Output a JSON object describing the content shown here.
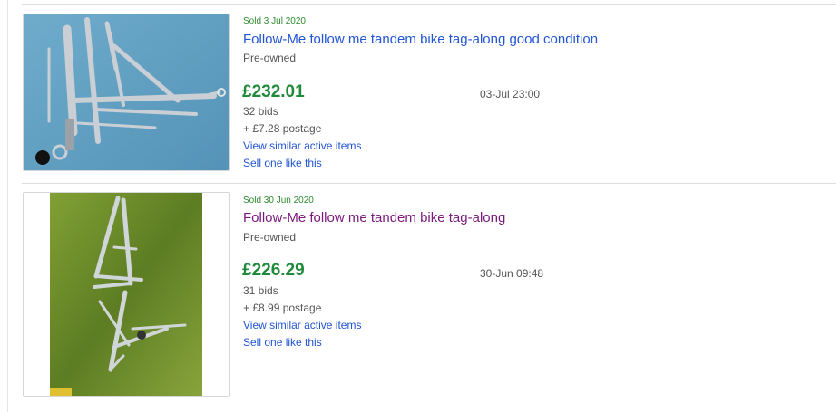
{
  "colors": {
    "price_green": "#1f8a3a",
    "link_blue": "#2155d4",
    "visited_purple": "#7a1a7c",
    "sold_green": "#2f8a2f"
  },
  "listings": [
    {
      "sold_label": "Sold 3 Jul 2020",
      "title": "Follow-Me follow me tandem bike tag-along good condition",
      "condition": "Pre-owned",
      "price": "£232.01",
      "end_time": "03-Jul 23:00",
      "bids": "32 bids",
      "postage": "+ £7.28 postage",
      "view_similar": "View similar active items",
      "sell_one": "Sell one like this",
      "image_alt": "Silver tag-along frame on blue background"
    },
    {
      "sold_label": "Sold 30 Jun 2020",
      "title": "Follow-Me follow me tandem bike tag-along",
      "condition": "Pre-owned",
      "price": "£226.29",
      "end_time": "30-Jun 09:48",
      "bids": "31 bids",
      "postage": "+ £8.99 postage",
      "view_similar": "View similar active items",
      "sell_one": "Sell one like this",
      "image_alt": "Tag-along frame lying on grass"
    }
  ]
}
